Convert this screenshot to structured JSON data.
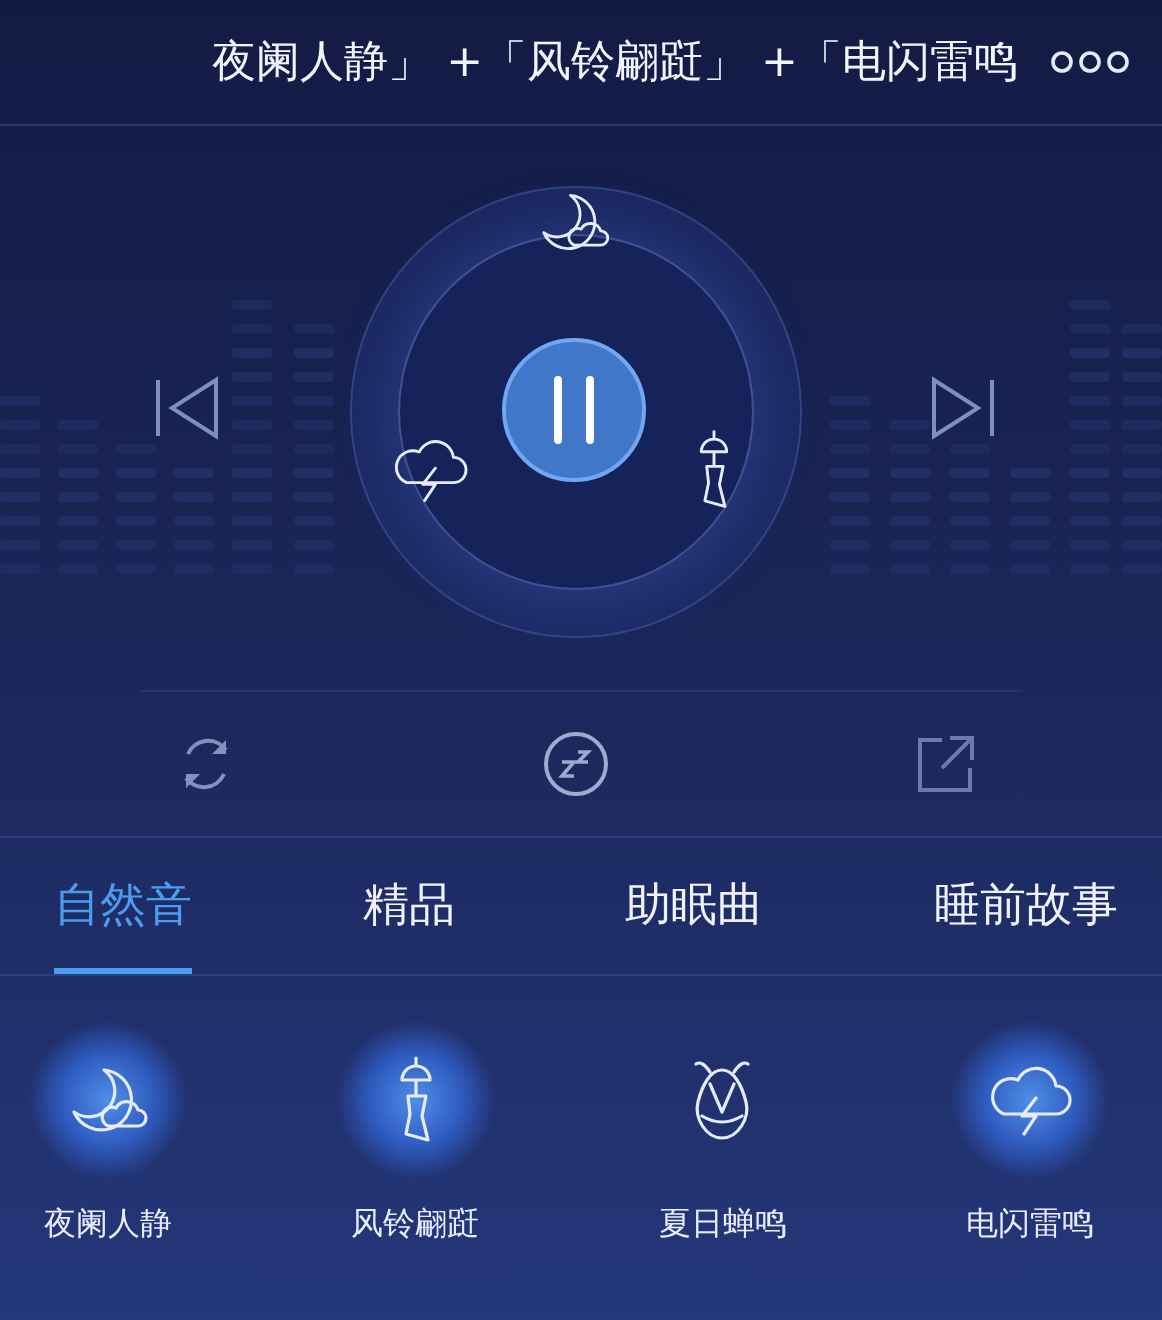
{
  "now_playing": {
    "title": "夜阑人静」 +「风铃翩跹」 +「电闪雷鸣"
  },
  "player": {
    "playing": true
  },
  "tabs": [
    {
      "label": "自然音",
      "selected": true
    },
    {
      "label": "精品",
      "selected": false
    },
    {
      "label": "助眠曲",
      "selected": false
    },
    {
      "label": "睡前故事",
      "selected": false
    }
  ],
  "sounds": [
    {
      "kind": "night",
      "label": "夜阑人静",
      "selected": true
    },
    {
      "kind": "bell",
      "label": "风铃翩跹",
      "selected": true
    },
    {
      "kind": "cicada",
      "label": "夏日蝉鸣",
      "selected": false
    },
    {
      "kind": "storm",
      "label": "电闪雷鸣",
      "selected": true
    }
  ]
}
